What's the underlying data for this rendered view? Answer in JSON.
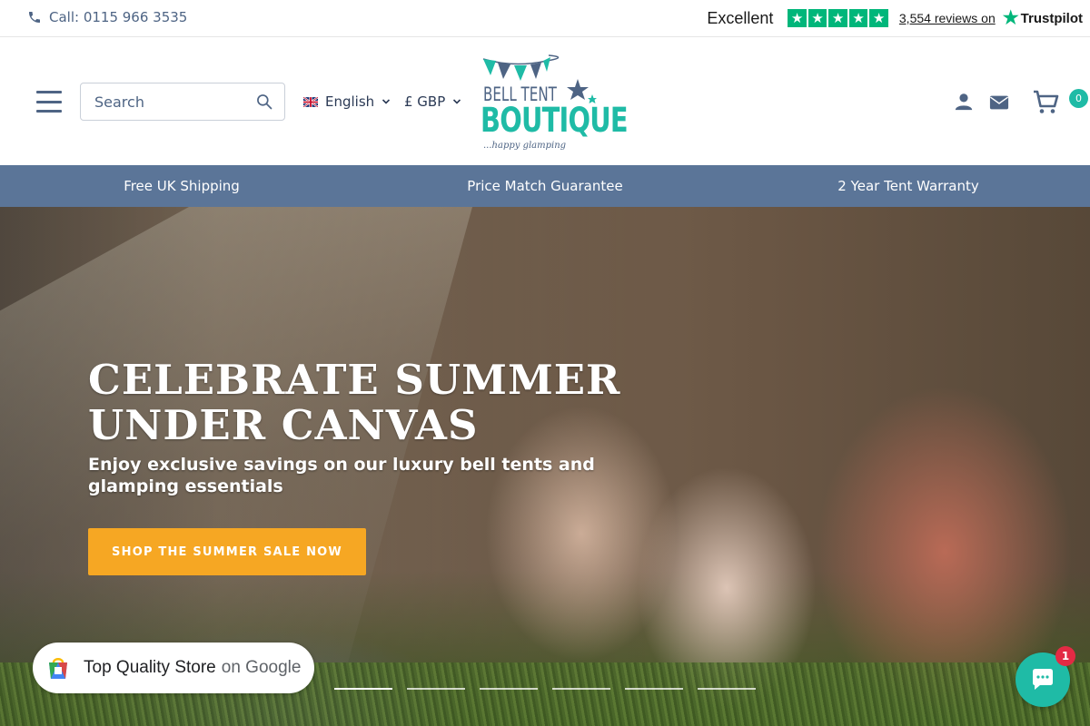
{
  "topbar": {
    "phone": "Call: 0115 966 3535",
    "trustpilot": {
      "rating_text": "Excellent",
      "stars": 5,
      "reviews": "3,554 reviews on",
      "brand": "Trustpilot",
      "star_color": "#00b67a"
    }
  },
  "header": {
    "search": {
      "placeholder": "Search"
    },
    "language": "English",
    "currency": "£ GBP",
    "logo": {
      "line1": "BELL TENT",
      "line2": "BOUTIQUE",
      "tagline": "...happy glamping"
    },
    "cart_count": "0",
    "accent": "#1fbba6"
  },
  "promo": {
    "items": [
      "Free UK Shipping",
      "Price Match Guarantee",
      "2 Year Tent Warranty"
    ],
    "background": "#5b7598"
  },
  "hero": {
    "title": "CELEBRATE SUMMER UNDER CANVAS",
    "subtitle": "Enjoy exclusive savings on our luxury bell tents and glamping essentials",
    "cta": "SHOP THE SUMMER SALE NOW",
    "cta_color": "#f6a723",
    "slides": 6,
    "active_slide": 1
  },
  "google_badge": {
    "text": "Top Quality Store",
    "suffix": "on Google"
  },
  "chat": {
    "badge": "1"
  }
}
